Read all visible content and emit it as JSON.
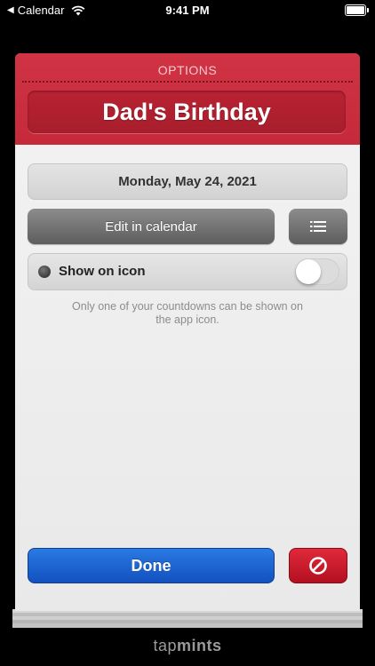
{
  "status_bar": {
    "back_app": "Calendar",
    "time": "9:41 PM"
  },
  "header": {
    "section_label": "OPTIONS",
    "title": "Dad's Birthday"
  },
  "event": {
    "date": "Monday, May 24, 2021",
    "edit_button_label": "Edit in calendar"
  },
  "show_on_icon": {
    "label": "Show on icon",
    "enabled": false,
    "hint": "Only one of your countdowns can be shown on the app icon."
  },
  "actions": {
    "done_label": "Done"
  },
  "branding": {
    "prefix": "tap",
    "suffix": "mints"
  },
  "colors": {
    "header_red": "#c62a3a",
    "done_blue": "#1a5fd0",
    "cancel_red": "#c8182a"
  }
}
